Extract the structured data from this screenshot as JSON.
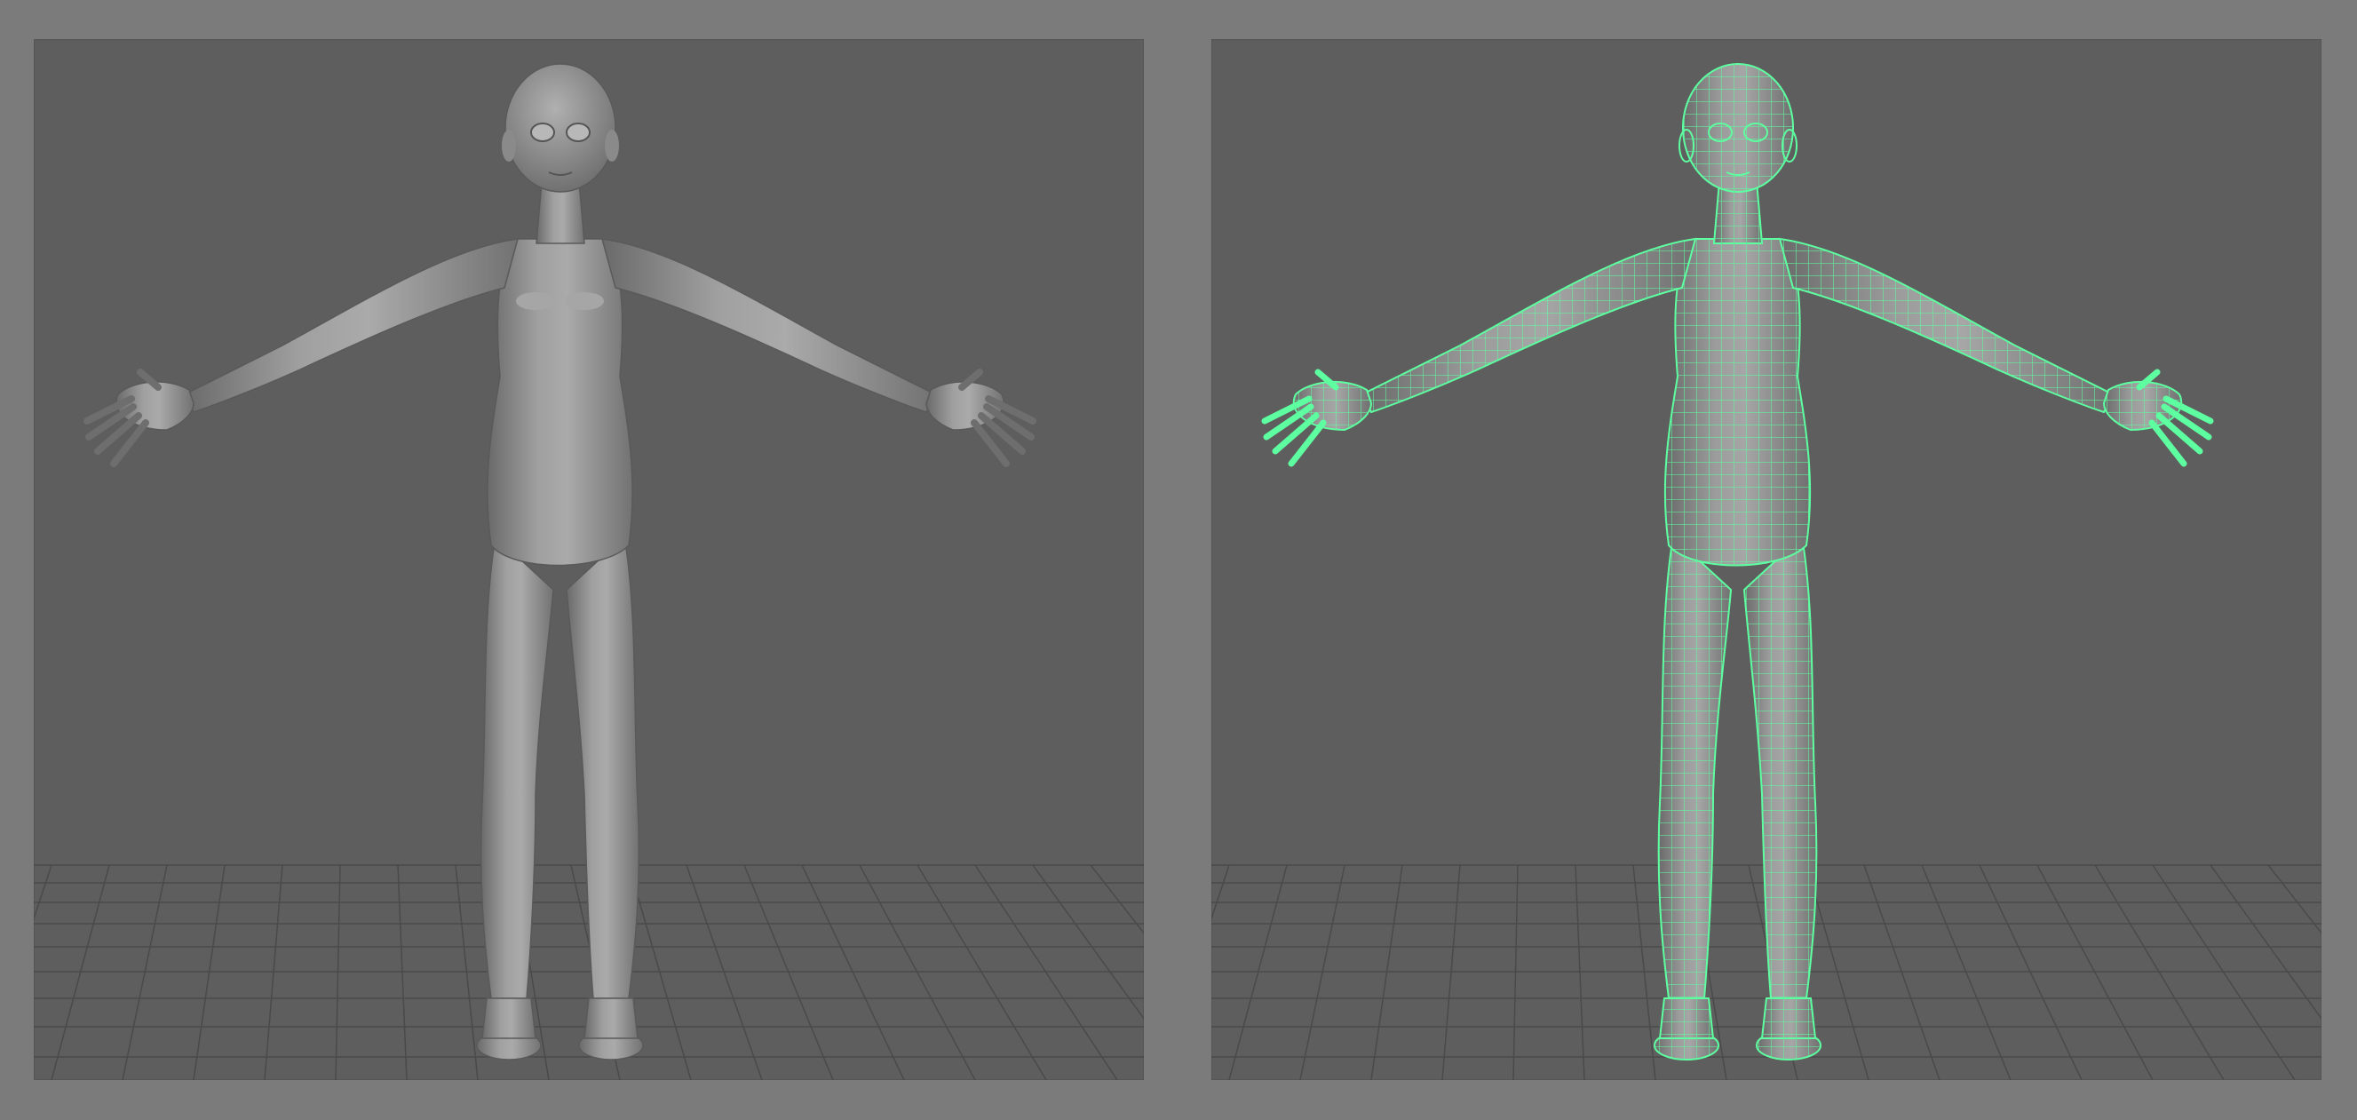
{
  "app": {
    "window_title": ""
  },
  "viewports": [
    {
      "id": "shaded",
      "display_mode": "smooth-shaded",
      "grid": true,
      "model": "humanoid-base-mesh"
    },
    {
      "id": "wireframe-on-shaded",
      "display_mode": "wireframe-on-shaded",
      "grid": true,
      "model": "humanoid-base-mesh"
    }
  ],
  "colors": {
    "background": "#7b7b7b",
    "viewport": "#5e5e5e",
    "grid_line": "#4a4a4a",
    "mesh_shaded": "#9a9a9a",
    "wireframe": "#5dffa0"
  }
}
